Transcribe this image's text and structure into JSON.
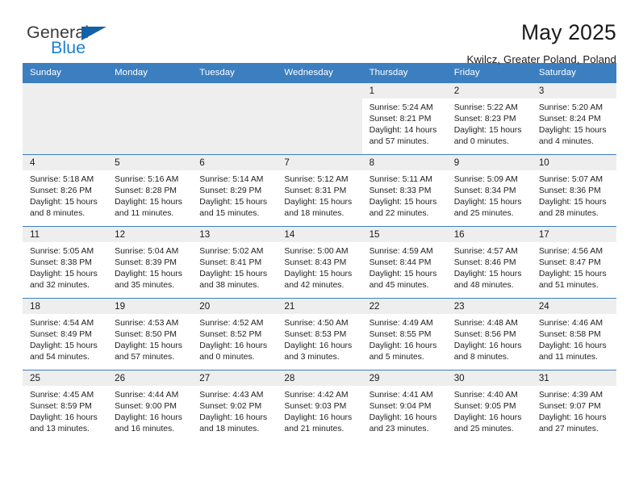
{
  "brand": {
    "name_part1": "General",
    "name_part2": "Blue",
    "triangle_color": "#1362a8",
    "blue": "#1f7fd0"
  },
  "header": {
    "title": "May 2025",
    "subtitle": "Kwilcz, Greater Poland, Poland"
  },
  "theme": {
    "header_row_bg": "#3c7fc1",
    "daynum_bg": "#eeeeee",
    "row_border": "#3c7fc1"
  },
  "labels": {
    "sunrise": "Sunrise:",
    "sunset": "Sunset:",
    "daylight": "Daylight:"
  },
  "weekdays": [
    "Sunday",
    "Monday",
    "Tuesday",
    "Wednesday",
    "Thursday",
    "Friday",
    "Saturday"
  ],
  "weeks": [
    [
      {
        "day": "",
        "empty": true
      },
      {
        "day": "",
        "empty": true
      },
      {
        "day": "",
        "empty": true
      },
      {
        "day": "",
        "empty": true
      },
      {
        "day": "1",
        "sunrise": "Sunrise: 5:24 AM",
        "sunset": "Sunset: 8:21 PM",
        "daylight_1": "Daylight: 14 hours",
        "daylight_2": "and 57 minutes."
      },
      {
        "day": "2",
        "sunrise": "Sunrise: 5:22 AM",
        "sunset": "Sunset: 8:23 PM",
        "daylight_1": "Daylight: 15 hours",
        "daylight_2": "and 0 minutes."
      },
      {
        "day": "3",
        "sunrise": "Sunrise: 5:20 AM",
        "sunset": "Sunset: 8:24 PM",
        "daylight_1": "Daylight: 15 hours",
        "daylight_2": "and 4 minutes."
      }
    ],
    [
      {
        "day": "4",
        "sunrise": "Sunrise: 5:18 AM",
        "sunset": "Sunset: 8:26 PM",
        "daylight_1": "Daylight: 15 hours",
        "daylight_2": "and 8 minutes."
      },
      {
        "day": "5",
        "sunrise": "Sunrise: 5:16 AM",
        "sunset": "Sunset: 8:28 PM",
        "daylight_1": "Daylight: 15 hours",
        "daylight_2": "and 11 minutes."
      },
      {
        "day": "6",
        "sunrise": "Sunrise: 5:14 AM",
        "sunset": "Sunset: 8:29 PM",
        "daylight_1": "Daylight: 15 hours",
        "daylight_2": "and 15 minutes."
      },
      {
        "day": "7",
        "sunrise": "Sunrise: 5:12 AM",
        "sunset": "Sunset: 8:31 PM",
        "daylight_1": "Daylight: 15 hours",
        "daylight_2": "and 18 minutes."
      },
      {
        "day": "8",
        "sunrise": "Sunrise: 5:11 AM",
        "sunset": "Sunset: 8:33 PM",
        "daylight_1": "Daylight: 15 hours",
        "daylight_2": "and 22 minutes."
      },
      {
        "day": "9",
        "sunrise": "Sunrise: 5:09 AM",
        "sunset": "Sunset: 8:34 PM",
        "daylight_1": "Daylight: 15 hours",
        "daylight_2": "and 25 minutes."
      },
      {
        "day": "10",
        "sunrise": "Sunrise: 5:07 AM",
        "sunset": "Sunset: 8:36 PM",
        "daylight_1": "Daylight: 15 hours",
        "daylight_2": "and 28 minutes."
      }
    ],
    [
      {
        "day": "11",
        "sunrise": "Sunrise: 5:05 AM",
        "sunset": "Sunset: 8:38 PM",
        "daylight_1": "Daylight: 15 hours",
        "daylight_2": "and 32 minutes."
      },
      {
        "day": "12",
        "sunrise": "Sunrise: 5:04 AM",
        "sunset": "Sunset: 8:39 PM",
        "daylight_1": "Daylight: 15 hours",
        "daylight_2": "and 35 minutes."
      },
      {
        "day": "13",
        "sunrise": "Sunrise: 5:02 AM",
        "sunset": "Sunset: 8:41 PM",
        "daylight_1": "Daylight: 15 hours",
        "daylight_2": "and 38 minutes."
      },
      {
        "day": "14",
        "sunrise": "Sunrise: 5:00 AM",
        "sunset": "Sunset: 8:43 PM",
        "daylight_1": "Daylight: 15 hours",
        "daylight_2": "and 42 minutes."
      },
      {
        "day": "15",
        "sunrise": "Sunrise: 4:59 AM",
        "sunset": "Sunset: 8:44 PM",
        "daylight_1": "Daylight: 15 hours",
        "daylight_2": "and 45 minutes."
      },
      {
        "day": "16",
        "sunrise": "Sunrise: 4:57 AM",
        "sunset": "Sunset: 8:46 PM",
        "daylight_1": "Daylight: 15 hours",
        "daylight_2": "and 48 minutes."
      },
      {
        "day": "17",
        "sunrise": "Sunrise: 4:56 AM",
        "sunset": "Sunset: 8:47 PM",
        "daylight_1": "Daylight: 15 hours",
        "daylight_2": "and 51 minutes."
      }
    ],
    [
      {
        "day": "18",
        "sunrise": "Sunrise: 4:54 AM",
        "sunset": "Sunset: 8:49 PM",
        "daylight_1": "Daylight: 15 hours",
        "daylight_2": "and 54 minutes."
      },
      {
        "day": "19",
        "sunrise": "Sunrise: 4:53 AM",
        "sunset": "Sunset: 8:50 PM",
        "daylight_1": "Daylight: 15 hours",
        "daylight_2": "and 57 minutes."
      },
      {
        "day": "20",
        "sunrise": "Sunrise: 4:52 AM",
        "sunset": "Sunset: 8:52 PM",
        "daylight_1": "Daylight: 16 hours",
        "daylight_2": "and 0 minutes."
      },
      {
        "day": "21",
        "sunrise": "Sunrise: 4:50 AM",
        "sunset": "Sunset: 8:53 PM",
        "daylight_1": "Daylight: 16 hours",
        "daylight_2": "and 3 minutes."
      },
      {
        "day": "22",
        "sunrise": "Sunrise: 4:49 AM",
        "sunset": "Sunset: 8:55 PM",
        "daylight_1": "Daylight: 16 hours",
        "daylight_2": "and 5 minutes."
      },
      {
        "day": "23",
        "sunrise": "Sunrise: 4:48 AM",
        "sunset": "Sunset: 8:56 PM",
        "daylight_1": "Daylight: 16 hours",
        "daylight_2": "and 8 minutes."
      },
      {
        "day": "24",
        "sunrise": "Sunrise: 4:46 AM",
        "sunset": "Sunset: 8:58 PM",
        "daylight_1": "Daylight: 16 hours",
        "daylight_2": "and 11 minutes."
      }
    ],
    [
      {
        "day": "25",
        "sunrise": "Sunrise: 4:45 AM",
        "sunset": "Sunset: 8:59 PM",
        "daylight_1": "Daylight: 16 hours",
        "daylight_2": "and 13 minutes."
      },
      {
        "day": "26",
        "sunrise": "Sunrise: 4:44 AM",
        "sunset": "Sunset: 9:00 PM",
        "daylight_1": "Daylight: 16 hours",
        "daylight_2": "and 16 minutes."
      },
      {
        "day": "27",
        "sunrise": "Sunrise: 4:43 AM",
        "sunset": "Sunset: 9:02 PM",
        "daylight_1": "Daylight: 16 hours",
        "daylight_2": "and 18 minutes."
      },
      {
        "day": "28",
        "sunrise": "Sunrise: 4:42 AM",
        "sunset": "Sunset: 9:03 PM",
        "daylight_1": "Daylight: 16 hours",
        "daylight_2": "and 21 minutes."
      },
      {
        "day": "29",
        "sunrise": "Sunrise: 4:41 AM",
        "sunset": "Sunset: 9:04 PM",
        "daylight_1": "Daylight: 16 hours",
        "daylight_2": "and 23 minutes."
      },
      {
        "day": "30",
        "sunrise": "Sunrise: 4:40 AM",
        "sunset": "Sunset: 9:05 PM",
        "daylight_1": "Daylight: 16 hours",
        "daylight_2": "and 25 minutes."
      },
      {
        "day": "31",
        "sunrise": "Sunrise: 4:39 AM",
        "sunset": "Sunset: 9:07 PM",
        "daylight_1": "Daylight: 16 hours",
        "daylight_2": "and 27 minutes."
      }
    ]
  ]
}
